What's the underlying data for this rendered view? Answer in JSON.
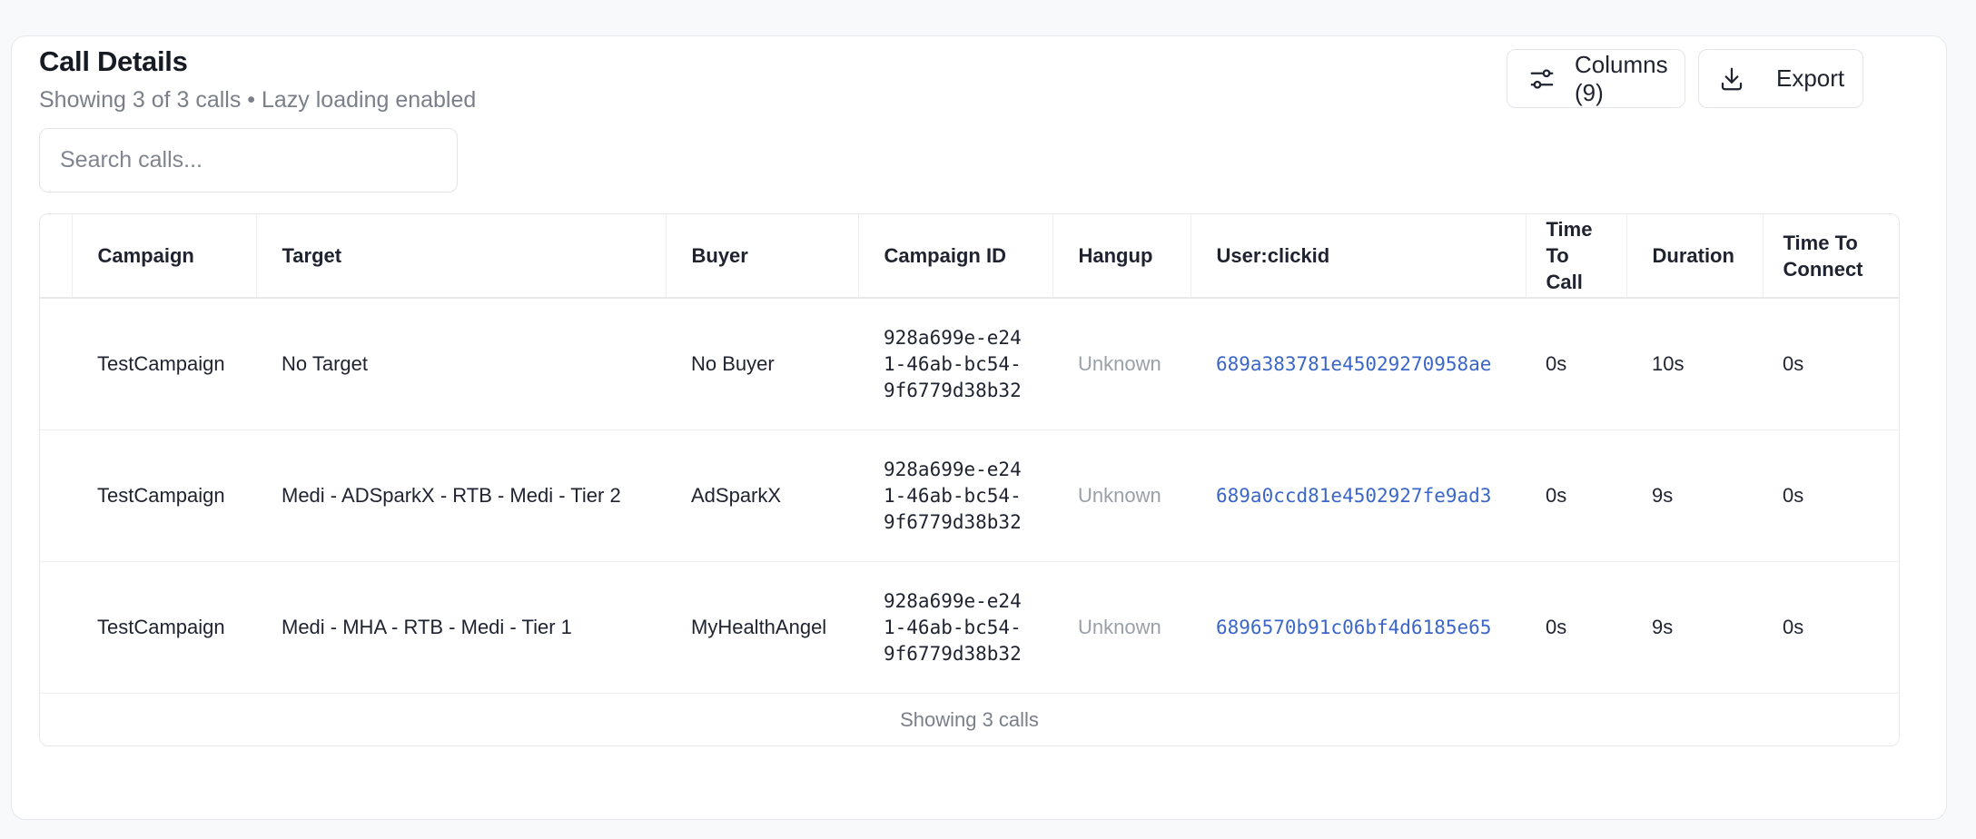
{
  "header": {
    "title": "Call Details",
    "subtitle": "Showing 3 of 3 calls • Lazy loading enabled"
  },
  "search": {
    "placeholder": "Search calls...",
    "value": ""
  },
  "toolbar": {
    "columns_label": "Columns (9)",
    "export_label": "Export",
    "columns_icon": "sliders-icon",
    "export_icon": "download-icon"
  },
  "table": {
    "columns": [
      "",
      "Campaign",
      "Target",
      "Buyer",
      "Campaign ID",
      "Hangup",
      "User:clickid",
      "Time To Call",
      "Duration",
      "Time To Connect"
    ],
    "rows": [
      {
        "campaign": "TestCampaign",
        "target": "No Target",
        "buyer": "No Buyer",
        "campaign_id": "928a699e-e241-46ab-bc54-9f6779d38b32",
        "hangup": "Unknown",
        "clickid": "689a383781e45029270958ae",
        "time_to_call": "0s",
        "duration": "10s",
        "time_to_connect": "0s"
      },
      {
        "campaign": "TestCampaign",
        "target": "Medi - ADSparkX - RTB - Medi - Tier 2",
        "buyer": "AdSparkX",
        "campaign_id": "928a699e-e241-46ab-bc54-9f6779d38b32",
        "hangup": "Unknown",
        "clickid": "689a0ccd81e4502927fe9ad3",
        "time_to_call": "0s",
        "duration": "9s",
        "time_to_connect": "0s"
      },
      {
        "campaign": "TestCampaign",
        "target": "Medi - MHA - RTB - Medi - Tier 1",
        "buyer": "MyHealthAngel",
        "campaign_id": "928a699e-e241-46ab-bc54-9f6779d38b32",
        "hangup": "Unknown",
        "clickid": "6896570b91c06bf4d6185e65",
        "time_to_call": "0s",
        "duration": "9s",
        "time_to_connect": "0s"
      }
    ],
    "footer": "Showing 3 calls"
  },
  "colors": {
    "link": "#3b66c8",
    "muted": "#9aa0a9",
    "border": "#e6e8ec"
  }
}
